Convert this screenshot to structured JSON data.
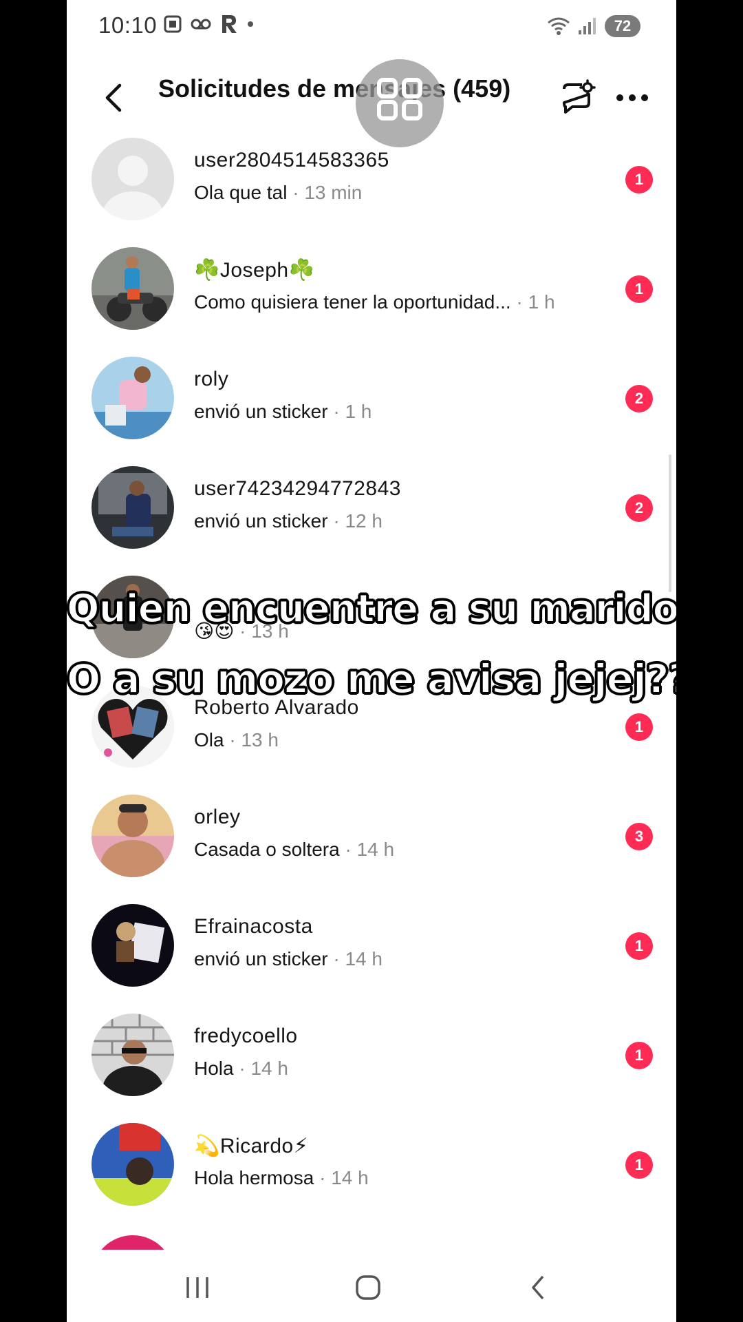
{
  "status_bar": {
    "time": "10:10",
    "battery": "72"
  },
  "header": {
    "title": "Solicitudes de mensajes (459)"
  },
  "conversations": [
    {
      "name": "user2804514583365",
      "message": "Ola que tal",
      "time": "13 min",
      "unread": "1"
    },
    {
      "name": "☘️Joseph☘️",
      "message": "Como quisiera tener la oportunidad...",
      "time": "1 h",
      "unread": "1"
    },
    {
      "name": "roly",
      "message": "envió un sticker",
      "time": "1 h",
      "unread": "2"
    },
    {
      "name": "user7423429477284​3",
      "message": "envió un sticker",
      "time": "12 h",
      "unread": "2"
    },
    {
      "name": "",
      "message": "😘😍",
      "time": "13 h",
      "unread": ""
    },
    {
      "name": "Roberto Alvarado",
      "message": "Ola",
      "time": "13 h",
      "unread": "1"
    },
    {
      "name": "orley",
      "message": "Casada o soltera",
      "time": "14 h",
      "unread": "3"
    },
    {
      "name": "Efrainacosta",
      "message": "envió un sticker",
      "time": "14 h",
      "unread": "1"
    },
    {
      "name": "fredycoello",
      "message": "Hola",
      "time": "14 h",
      "unread": "1"
    },
    {
      "name": "💫Ricardo⚡",
      "message": "Hola hermosa",
      "time": "14 h",
      "unread": "1"
    }
  ],
  "caption": {
    "line1": "Quien encuentre a su marido",
    "line2": "O  a su mozo me avisa jejej??"
  },
  "colors": {
    "badge": "#fe2c55",
    "meta_text": "#8a8a8a"
  },
  "icons": [
    "back-arrow-icon",
    "compose-settings-icon",
    "more-options-icon",
    "nav-recents-icon",
    "nav-home-icon",
    "nav-back-icon"
  ]
}
